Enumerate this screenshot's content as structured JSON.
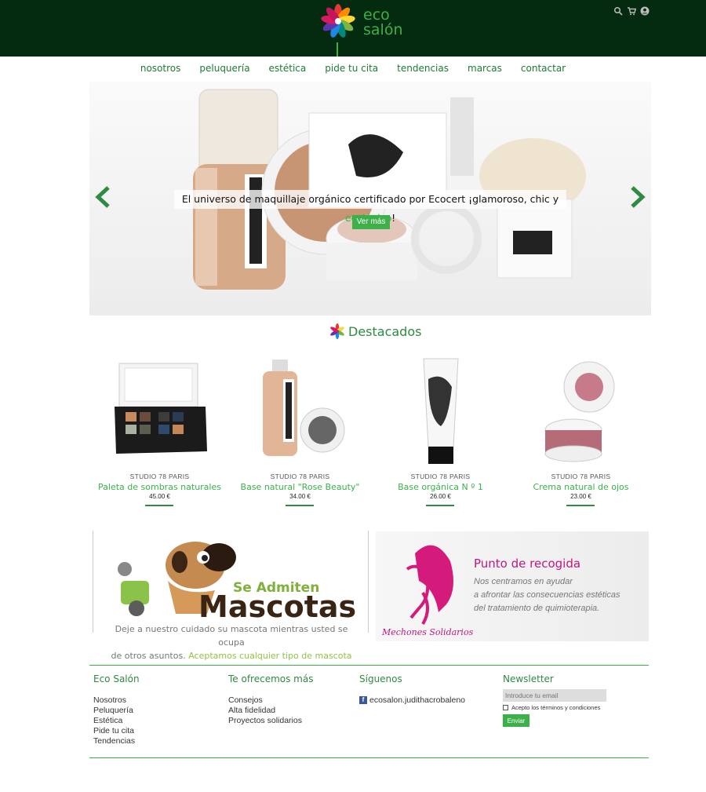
{
  "header": {
    "logo_line1": "eco",
    "logo_line2": "salón",
    "icons": [
      "search-icon",
      "cart-icon",
      "user-icon"
    ]
  },
  "nav": [
    "nosotros",
    "peluquería",
    "estética",
    "pide tu cita",
    "tendencias",
    "marcas",
    "contactar"
  ],
  "hero": {
    "text_before": "El universo de maquillaje orgánico certificado por Ecocert ¡glamoroso, chic y ",
    "text_highlight": "ecológico",
    "text_after": "!",
    "button": "Ver más"
  },
  "featured": {
    "title": "Destacados",
    "products": [
      {
        "brand": "STUDIO 78 PARIS",
        "name": "Paleta de sombras naturales",
        "price": "45.00 €"
      },
      {
        "brand": "STUDIO 78 PARIS",
        "name": "Base natural \"Rose Beauty\"",
        "price": "34.00 €"
      },
      {
        "brand": "STUDIO 78 PARIS",
        "name": "Base orgánica N º 1",
        "price": "26.00 €"
      },
      {
        "brand": "STUDIO 78 PARIS",
        "name": "Crema natural de ojos",
        "price": "23.00 €"
      }
    ]
  },
  "pets": {
    "line1": "Se Admiten",
    "line2": "Mascotas",
    "caption1": "Deje a nuestro cuidado su mascota mientras usted se ocupa",
    "caption2": "de otros asuntos. ",
    "caption_link": "Aceptamos cualquier tipo de mascota"
  },
  "pickup": {
    "title": "Punto de recogida",
    "line1": "Nos centramos en ayudar",
    "line2": "a afrontar las consecuencias estéticas",
    "line3": "del tratamiento de quimioterapia.",
    "script": "Mechones Solidarios"
  },
  "footer": {
    "col1": {
      "title": "Eco Salón",
      "items": [
        "Nosotros",
        "Peluquería",
        "Estética",
        "Pide tu cita",
        "Tendencias"
      ]
    },
    "col2": {
      "title": "Te ofrecemos más",
      "items": [
        "Consejos",
        "Alta fidelidad",
        "Proyectos solidarios"
      ]
    },
    "col3": {
      "title": "Síguenos",
      "fb": "ecosalon.judithacrobaleno"
    },
    "col4": {
      "title": "Newsletter",
      "placeholder": "Introduce tu email",
      "terms": "Acepto los términos y condiciones",
      "button": "Enviar"
    }
  }
}
